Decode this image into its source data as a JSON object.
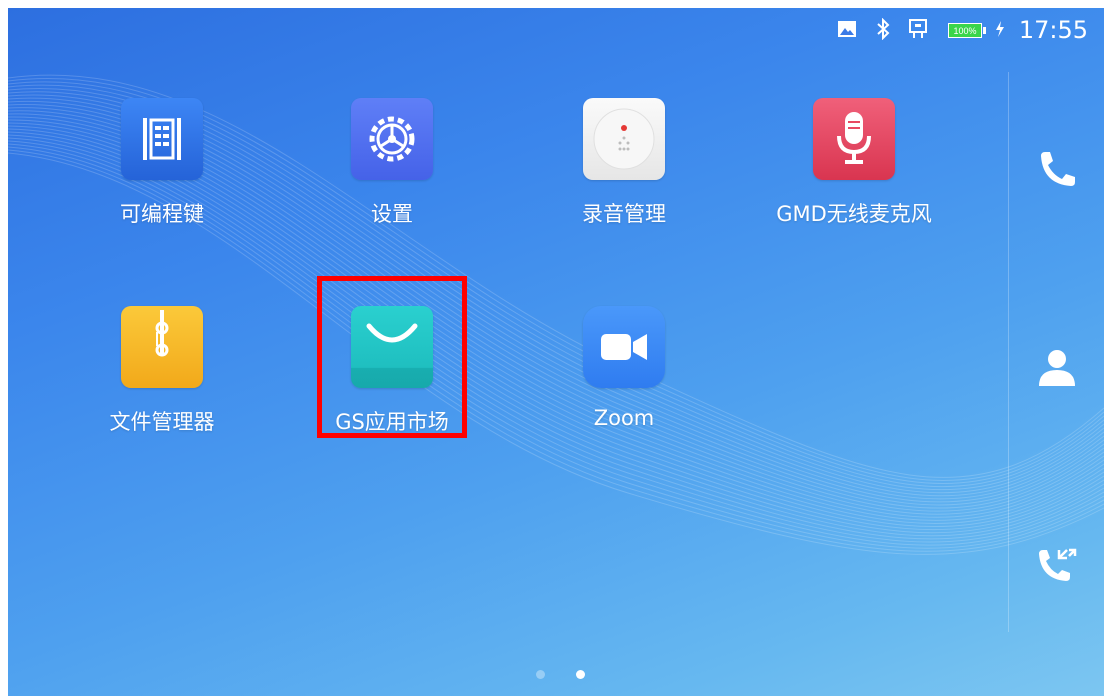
{
  "status_bar": {
    "time": "17:55",
    "battery_text": "100%",
    "icons": [
      "image-icon",
      "bluetooth-icon",
      "network-icon",
      "battery-icon",
      "charging-icon"
    ]
  },
  "apps": [
    {
      "label": "可编程键",
      "icon": "programmable-keys-icon",
      "bg": "#2f6fe6"
    },
    {
      "label": "设置",
      "icon": "settings-gear-icon",
      "bg": "#4d6ff0"
    },
    {
      "label": "录音管理",
      "icon": "recorder-icon",
      "bg": "#eeeeee"
    },
    {
      "label": "GMD无线麦克风",
      "icon": "microphone-icon",
      "bg": "#e84a62"
    },
    {
      "label": "文件管理器",
      "icon": "file-manager-icon",
      "bg": "#f6b926"
    },
    {
      "label": "GS应用市场",
      "icon": "app-market-bag-icon",
      "bg": "#1fc2c3"
    },
    {
      "label": "Zoom",
      "icon": "zoom-camera-icon",
      "bg": "#3b8cf7"
    }
  ],
  "dock": {
    "icons": [
      "phone-icon",
      "contacts-icon",
      "call-history-icon"
    ]
  },
  "page_indicator": {
    "total": 2,
    "current": 2
  },
  "highlight": {
    "target": "GS应用市场",
    "color": "#ff0000"
  }
}
